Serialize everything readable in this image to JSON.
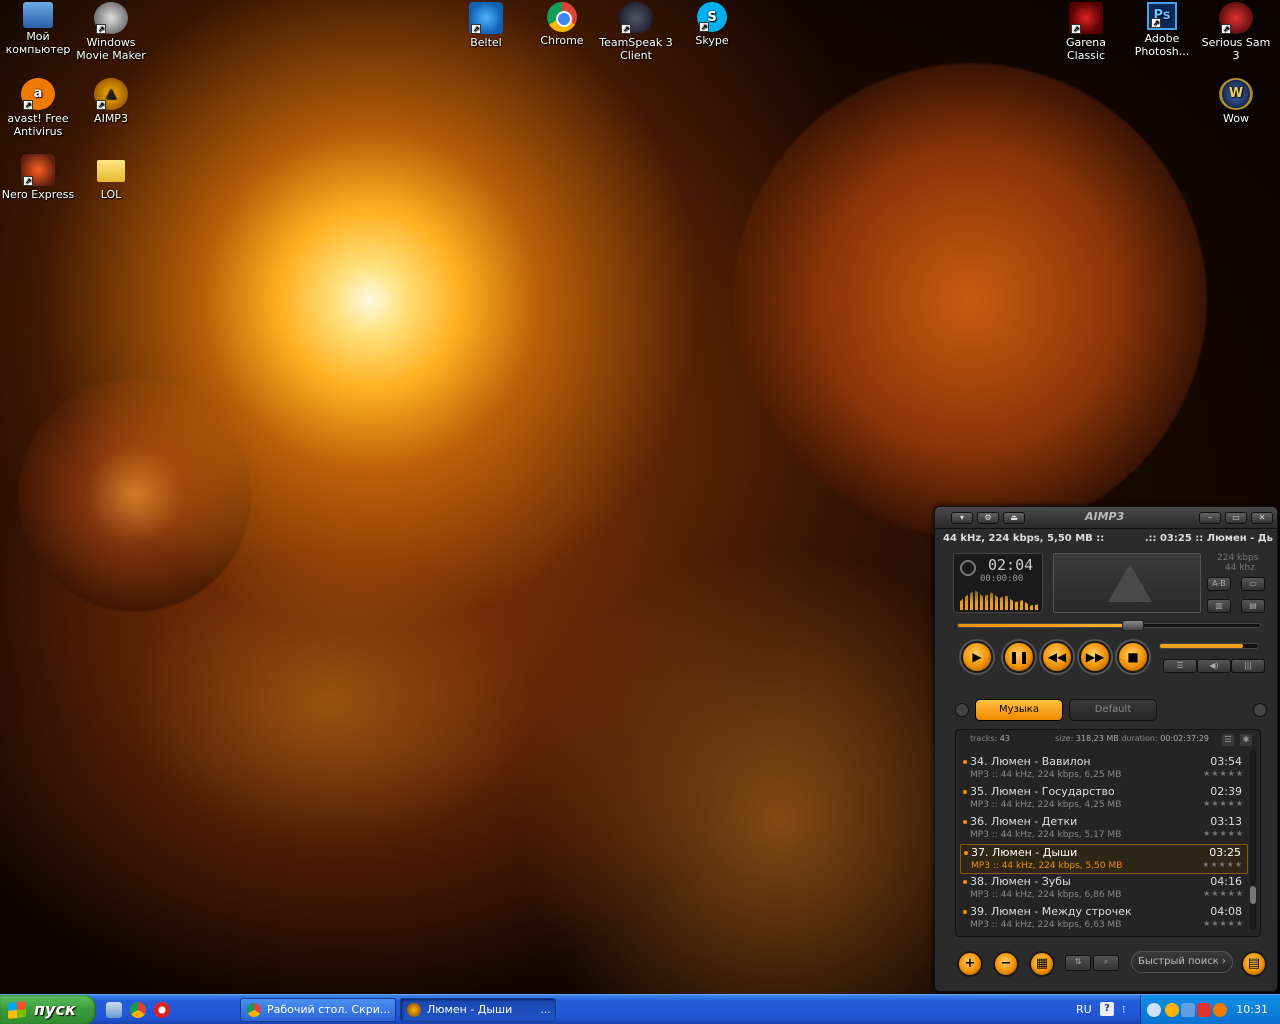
{
  "desktop_icons": [
    {
      "label": "Мой компьютер",
      "icon": "my-computer-icon"
    },
    {
      "label": "Windows Movie Maker",
      "icon": "movie-maker-icon"
    },
    {
      "label": "avast! Free Antivirus",
      "icon": "avast-icon"
    },
    {
      "label": "AIMP3",
      "icon": "aimp-icon"
    },
    {
      "label": "Nero Express",
      "icon": "nero-icon"
    },
    {
      "label": "LOL",
      "icon": "folder-icon"
    },
    {
      "label": "Beltel",
      "icon": "beltel-icon"
    },
    {
      "label": "Chrome",
      "icon": "chrome-icon"
    },
    {
      "label": "TeamSpeak 3 Client",
      "icon": "teamspeak-icon"
    },
    {
      "label": "Skype",
      "icon": "skype-icon"
    },
    {
      "label": "Garena Classic",
      "icon": "garena-icon"
    },
    {
      "label": "Adobe Photosh...",
      "icon": "photoshop-icon"
    },
    {
      "label": "Serious Sam 3",
      "icon": "serious-sam-icon"
    },
    {
      "label": "Wow",
      "icon": "wow-icon"
    }
  ],
  "aimp": {
    "logo": "AIMP3",
    "info_left": "44 kHz, 224 kbps, 5,50 MB ::",
    "info_right": ".:: 03:25 :: Люмен - Дь",
    "time": "02:04",
    "time_sub": "00:00:00",
    "bitrate": "224 kbps",
    "samplerate": "44 khz",
    "ab_label": "A-B",
    "seek_progress": 0.58,
    "volume": 0.85,
    "tabs": [
      {
        "label": "Музыка",
        "active": true
      },
      {
        "label": "Default",
        "active": false
      }
    ],
    "playlist_header": {
      "tracks_label": "tracks:",
      "tracks": "43",
      "size_label": "size:",
      "size": "318,23 MB",
      "duration_label": "duration:",
      "duration": "00:02:37:29"
    },
    "tracks": [
      {
        "title": "34. Люмен - Вавилон",
        "duration": "03:54",
        "meta": "MP3 :: 44 kHz, 224 kbps, 6,25 MB",
        "current": false
      },
      {
        "title": "35. Люмен - Государство",
        "duration": "02:39",
        "meta": "MP3 :: 44 kHz, 224 kbps, 4,25 MB",
        "current": false
      },
      {
        "title": "36. Люмен - Детки",
        "duration": "03:13",
        "meta": "MP3 :: 44 kHz, 224 kbps, 5,17 MB",
        "current": false
      },
      {
        "title": "37. Люмен - Дыши",
        "duration": "03:25",
        "meta": "MP3 :: 44 kHz, 224 kbps, 5,50 MB",
        "current": true
      },
      {
        "title": "38. Люмен - Зубы",
        "duration": "04:16",
        "meta": "MP3 :: 44 kHz, 224 kbps, 6,86 MB",
        "current": false
      },
      {
        "title": "39. Люмен - Между строчек",
        "duration": "04:08",
        "meta": "MP3 :: 44 kHz, 224 kbps, 6,63 MB",
        "current": false
      }
    ],
    "search_label": "Быстрый поиск"
  },
  "taskbar": {
    "start_label": "пуск",
    "tasks": [
      {
        "label": "Рабочий стол. Скри...",
        "icon": "chrome-icon",
        "active": false
      },
      {
        "label": "Люмен - Дыши        ...",
        "icon": "aimp-icon",
        "active": true
      }
    ],
    "lang": "RU",
    "clock": "10:31"
  },
  "colors": {
    "accent": "#f09000",
    "taskbar": "#245edb",
    "start": "#3a9a3a"
  }
}
